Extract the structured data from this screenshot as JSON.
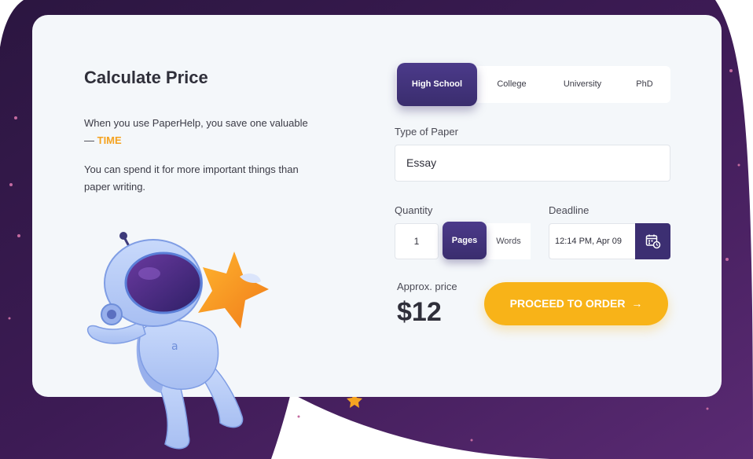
{
  "title": "Calculate Price",
  "intro": {
    "line1": "When you use PaperHelp, you save one valuable — ",
    "highlight": "TIME",
    "line2": "You can spend it for more important things than paper writing."
  },
  "tabs": [
    {
      "label": "High School",
      "active": true
    },
    {
      "label": "College",
      "active": false
    },
    {
      "label": "University",
      "active": false
    },
    {
      "label": "PhD",
      "active": false
    }
  ],
  "paper": {
    "label": "Type of Paper",
    "value": "Essay"
  },
  "quantity": {
    "label": "Quantity",
    "value": "1",
    "units": [
      "Pages",
      "Words"
    ],
    "selected_unit": "Pages"
  },
  "deadline": {
    "label": "Deadline",
    "value": "12:14 PM, Apr 09"
  },
  "price": {
    "label": "Approx. price",
    "value": "$12"
  },
  "order_button": {
    "label": "PROCEED TO ORDER",
    "arrow": "→"
  },
  "colors": {
    "accent": "#f5a321",
    "primary": "#3c2f72",
    "button": "#f8b318",
    "background": "#3b1d52"
  },
  "icons": {
    "calendar": "calendar-clock-icon",
    "astronaut": "astronaut-illustration",
    "star": "star-icon"
  }
}
